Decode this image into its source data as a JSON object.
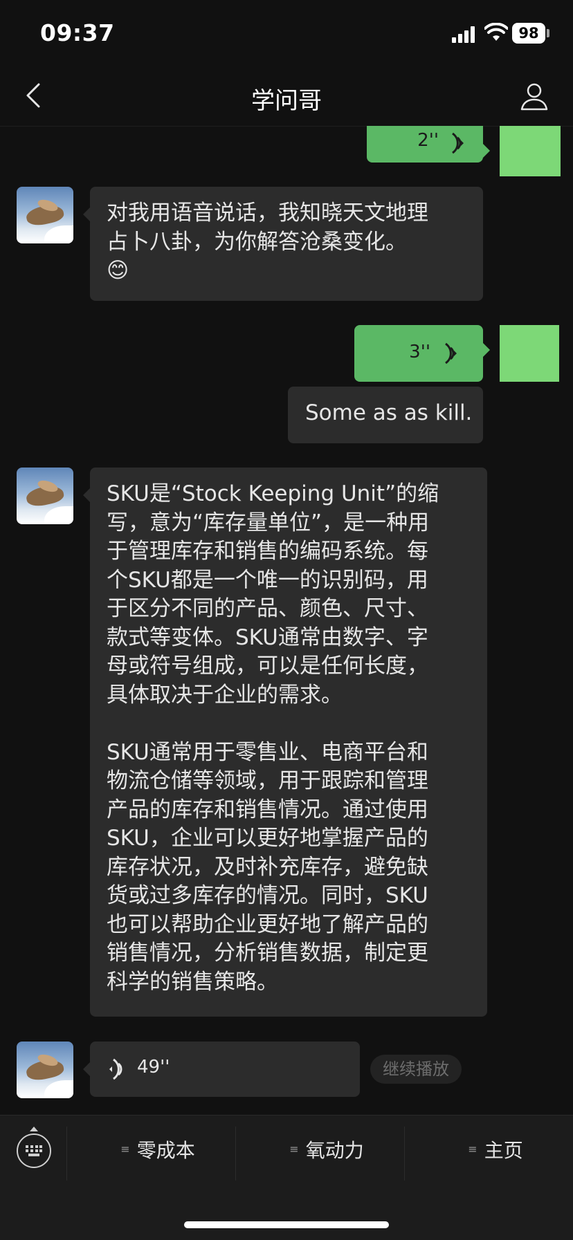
{
  "status_bar": {
    "time": "09:37",
    "battery": "98"
  },
  "nav": {
    "title": "学问哥"
  },
  "messages": {
    "voice_out_1": {
      "duration": "2''"
    },
    "bot_reply_1": {
      "text": "对我用语音说话，我知晓天文地理\n占卜八卦，为你解答沧桑变化。\n😊"
    },
    "voice_out_2": {
      "duration": "3''"
    },
    "transcript": {
      "text": "Some as as kill."
    },
    "bot_reply_2": {
      "text": "SKU是“Stock Keeping Unit”的缩\n写，意为“库存量单位”，是一种用\n于管理库存和销售的编码系统。每\n个SKU都是一个唯一的识别码，用\n于区分不同的产品、颜色、尺寸、\n款式等变体。SKU通常由数字、字\n母或符号组成，可以是任何长度，\n具体取决于企业的需求。\n\nSKU通常用于零售业、电商平台和\n物流仓储等领域，用于跟踪和管理\n产品的库存和销售情况。通过使用\nSKU，企业可以更好地掌握产品的\n库存状况，及时补充库存，避免缺\n货或过多库存的情况。同时，SKU\n也可以帮助企业更好地了解产品的\n销售情况，分析销售数据，制定更\n科学的销售策略。"
    },
    "voice_in": {
      "duration": "49''",
      "continue_label": "继续播放"
    }
  },
  "menu": {
    "items": [
      {
        "label": "零成本"
      },
      {
        "label": "氧动力"
      },
      {
        "label": "主页"
      }
    ]
  },
  "colors": {
    "bubble_out": "#5bb865",
    "bubble_in": "#2c2c2c",
    "background": "#111111"
  }
}
